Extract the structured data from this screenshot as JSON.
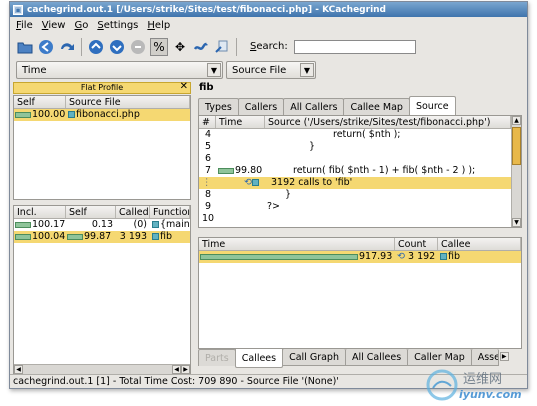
{
  "window": {
    "title": "cachegrind.out.1 [/Users/strike/Sites/test/fibonacci.php] - KCachegrind"
  },
  "menu": [
    "File",
    "View",
    "Go",
    "Settings",
    "Help"
  ],
  "toolbar": {
    "icons": [
      "open-icon",
      "back-icon",
      "forward-icon",
      "up-icon",
      "down-icon",
      "stop-icon",
      "percent-icon",
      "move-icon",
      "cycle-icon",
      "dump-icon"
    ],
    "percent_glyph": "%",
    "search_label": "Search:",
    "search_value": ""
  },
  "combos": {
    "event": "Time",
    "grouping": "Source File"
  },
  "flat_profile": {
    "title": "Flat Profile",
    "headers": [
      "Self",
      "Source File"
    ],
    "rows": [
      {
        "self": "100.00",
        "file": "fibonacci.php"
      }
    ]
  },
  "callers": {
    "headers": [
      "Incl.",
      "Self",
      "Called",
      "Function"
    ],
    "rows": [
      {
        "incl": "100.17",
        "self": "0.13",
        "called": "(0)",
        "function": "{main}"
      },
      {
        "incl": "100.04",
        "self": "99.87",
        "called": "3 193",
        "function": "fib"
      }
    ]
  },
  "function_name": "fib",
  "tabs_top": [
    "Types",
    "Callers",
    "All Callers",
    "Callee Map",
    "Source"
  ],
  "source": {
    "headers": [
      "#",
      "Time",
      "Source ('/Users/strike/Sites/test/fibonacci.php')"
    ],
    "lines": [
      {
        "num": "4",
        "time": "",
        "code": "return( $nth );"
      },
      {
        "num": "5",
        "time": "",
        "code": "}"
      },
      {
        "num": "6",
        "time": "",
        "code": ""
      },
      {
        "num": "7",
        "time": "99.80",
        "code": "return( fib( $nth - 1) + fib( $nth - 2 ) );"
      },
      {
        "num": "",
        "time": "",
        "code": "3192 calls to 'fib'"
      },
      {
        "num": "8",
        "time": "",
        "code": "}"
      },
      {
        "num": "9",
        "time": "",
        "code": "?>"
      },
      {
        "num": "10",
        "time": "",
        "code": ""
      }
    ]
  },
  "callees": {
    "headers": [
      "Time",
      "Count",
      "Callee"
    ],
    "rows": [
      {
        "time": "917.93",
        "count": "3 192",
        "callee": "fib"
      }
    ]
  },
  "tabs_bottom": [
    "Parts",
    "Callees",
    "Call Graph",
    "All Callees",
    "Caller Map",
    "Assembly"
  ],
  "status": "cachegrind.out.1 [1] - Total Time Cost:  709 890 - Source File '(None)'",
  "watermark": {
    "cn": "运维网",
    "url": "iyunv.com"
  }
}
